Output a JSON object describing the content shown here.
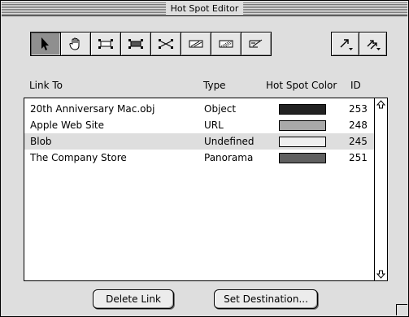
{
  "window": {
    "title": "Hot Spot Editor"
  },
  "toolbar": {
    "tools": [
      {
        "icon": "arrow-pointer-icon",
        "active": true
      },
      {
        "icon": "hand-icon",
        "active": false
      },
      {
        "icon": "rect-hotspot-icon",
        "active": false
      },
      {
        "icon": "rect-hotspot-filled-icon",
        "active": false
      },
      {
        "icon": "rect-hotspot-cross-icon",
        "active": false
      },
      {
        "icon": "trapezoid-hotspot-icon",
        "active": false
      },
      {
        "icon": "trapezoid-hotspot-dotted-icon",
        "active": false
      },
      {
        "icon": "trapezoid-hotspot-edit-icon",
        "active": false
      }
    ],
    "right_tools": [
      {
        "icon": "diagonal-arrow-menu-icon"
      },
      {
        "icon": "double-arrow-menu-icon"
      }
    ]
  },
  "table": {
    "headers": {
      "link_to": "Link To",
      "type": "Type",
      "color": "Hot Spot Color",
      "id": "ID"
    },
    "rows": [
      {
        "link_to": "20th Anniversary Mac.obj",
        "type": "Object",
        "color": "#222222",
        "id": "253",
        "selected": false
      },
      {
        "link_to": "Apple Web Site",
        "type": "URL",
        "color": "#a9a9a9",
        "id": "248",
        "selected": false
      },
      {
        "link_to": "Blob",
        "type": "Undefined",
        "color": "#efefef",
        "id": "245",
        "selected": true
      },
      {
        "link_to": "The Company Store",
        "type": "Panorama",
        "color": "#5f5f5f",
        "id": "251",
        "selected": false
      }
    ]
  },
  "buttons": {
    "delete": "Delete Link",
    "set_destination": "Set Destination..."
  },
  "colors": {
    "window_bg": "#dedede",
    "selection": "#dedede",
    "tool_active": "#8f8f8f"
  }
}
